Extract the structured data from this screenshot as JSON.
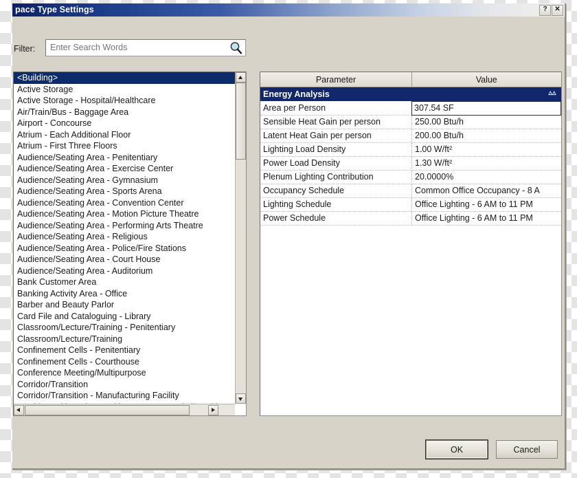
{
  "window": {
    "title": "pace Type Settings",
    "help_button": "?",
    "close_button": "✕"
  },
  "filter": {
    "label": "Filter:",
    "placeholder": "Enter Search Words",
    "value": "",
    "icon": "search-icon"
  },
  "space_type_list": {
    "selected_index": 0,
    "items": [
      "<Building>",
      "Active Storage",
      "Active Storage - Hospital/Healthcare",
      "Air/Train/Bus - Baggage Area",
      "Airport - Concourse",
      "Atrium - Each Additional Floor",
      "Atrium - First Three Floors",
      "Audience/Seating Area - Penitentiary",
      "Audience/Seating Area - Exercise Center",
      "Audience/Seating Area - Gymnasium",
      "Audience/Seating Area - Sports Arena",
      "Audience/Seating Area - Convention Center",
      "Audience/Seating Area - Motion Picture Theatre",
      "Audience/Seating Area - Performing Arts Theatre",
      "Audience/Seating Area - Religious",
      "Audience/Seating Area - Police/Fire Stations",
      "Audience/Seating Area - Court House",
      "Audience/Seating Area - Auditorium",
      "Bank Customer Area",
      "Banking Activity Area - Office",
      "Barber and Beauty Parlor",
      "Card File and Cataloguing - Library",
      "Classroom/Lecture/Training - Penitentiary",
      "Classroom/Lecture/Training",
      "Confinement Cells - Penitentiary",
      "Confinement Cells - Courthouse",
      "Conference Meeting/Multipurpose",
      "Corridor/Transition",
      "Corridor/Transition - Manufacturing Facility",
      "Corridors with Patient Waiting Exam - Hospital/Health"
    ]
  },
  "parameters_table": {
    "columns": [
      "Parameter",
      "Value"
    ],
    "group": {
      "label": "Energy Analysis",
      "collapse_icon": "«",
      "collapsed": false
    },
    "rows": [
      {
        "parameter": "Area per Person",
        "value": "307.54 SF",
        "active": true
      },
      {
        "parameter": "Sensible Heat Gain per person",
        "value": "250.00 Btu/h",
        "active": false
      },
      {
        "parameter": "Latent Heat Gain per person",
        "value": "200.00 Btu/h",
        "active": false
      },
      {
        "parameter": "Lighting Load Density",
        "value": "1.00 W/ft²",
        "active": false
      },
      {
        "parameter": "Power Load Density",
        "value": "1.30 W/ft²",
        "active": false
      },
      {
        "parameter": "Plenum Lighting Contribution",
        "value": "20.0000%",
        "active": false
      },
      {
        "parameter": "Occupancy Schedule",
        "value": "Common Office Occupancy - 8 A",
        "active": false
      },
      {
        "parameter": "Lighting Schedule",
        "value": "Office Lighting - 6 AM to 11 PM",
        "active": false
      },
      {
        "parameter": "Power Schedule",
        "value": "Office Lighting - 6 AM to 11 PM",
        "active": false
      }
    ]
  },
  "footer": {
    "ok_label": "OK",
    "cancel_label": "Cancel"
  },
  "colors": {
    "titlebar_start": "#0c1f63",
    "group_header": "#11266b",
    "selection": "#0c2b6b",
    "dialog_face": "#d6d2c8",
    "search_icon_fill": "#add8e6"
  }
}
